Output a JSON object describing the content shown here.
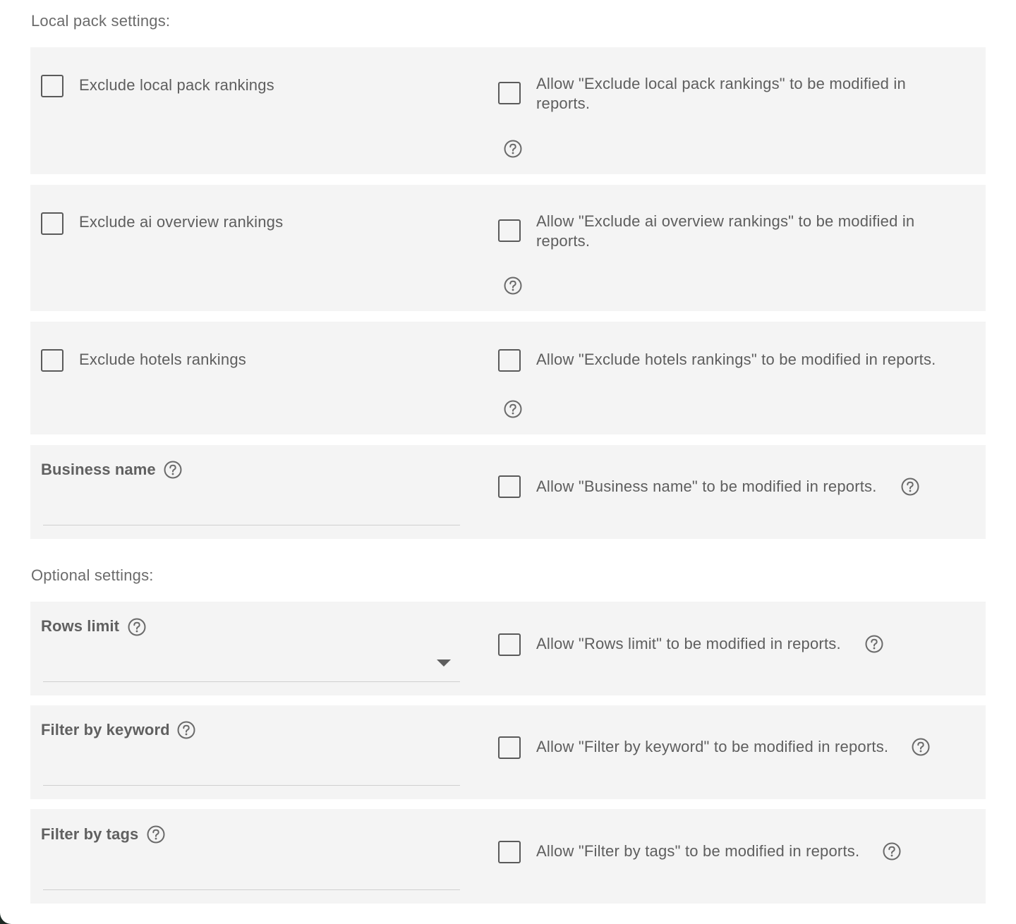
{
  "local_pack": {
    "title": "Local pack settings:",
    "rows": [
      {
        "label": "Exclude local pack rankings",
        "allow_label": "Allow \"Exclude local pack rankings\" to be modified in reports."
      },
      {
        "label": "Exclude ai overview rankings",
        "allow_label": "Allow \"Exclude ai overview rankings\" to be modified in reports."
      },
      {
        "label": "Exclude hotels rankings",
        "allow_label": "Allow \"Exclude hotels rankings\" to be modified in reports."
      }
    ],
    "business_name": {
      "label": "Business name",
      "value": "",
      "allow_label": "Allow \"Business name\" to be modified in reports."
    }
  },
  "optional": {
    "title": "Optional settings:",
    "rows_limit": {
      "label": "Rows limit",
      "value": "",
      "allow_label": "Allow \"Rows limit\" to be modified in reports."
    },
    "filter_keyword": {
      "label": "Filter by keyword",
      "value": "",
      "allow_label": "Allow \"Filter by keyword\" to be modified in reports."
    },
    "filter_tags": {
      "label": "Filter by tags",
      "value": "",
      "allow_label": "Allow \"Filter by tags\" to be modified in reports."
    }
  },
  "icons": {
    "help": "question-circle-icon",
    "dropdown": "caret-down-icon"
  },
  "colors": {
    "card_background": "#f4f4f4",
    "text": "#5e5e5e",
    "checkbox_border": "#5a5a5a"
  }
}
